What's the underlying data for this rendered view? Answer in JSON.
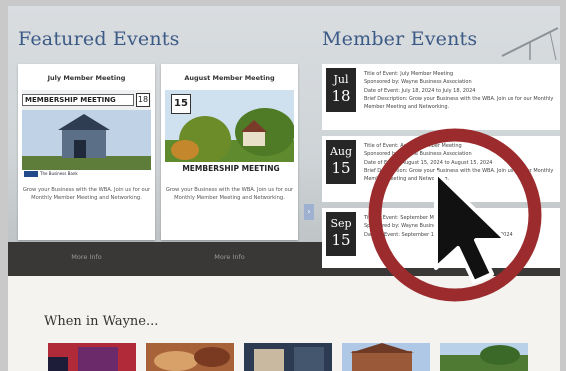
{
  "sections": {
    "featured_title": "Featured Events",
    "member_title": "Member Events",
    "wayne_title": "When in Wayne..."
  },
  "featured": [
    {
      "title": "July Member Meeting",
      "image_banner": "MEMBERSHIP MEETING",
      "image_corner": "18",
      "image_caption": "The Business Bank",
      "description": "Grow your Business with the WBA. Join us for our Monthly Member Meeting and Networking.",
      "more": "More Info"
    },
    {
      "title": "August Member Meeting",
      "image_banner": "MEMBERSHIP MEETING",
      "image_corner": "15",
      "description": "Grow your Business with the WBA. Join us for our Monthly Member Meeting and Networking.",
      "more": "More Info"
    }
  ],
  "member_events": [
    {
      "month": "Jul",
      "day": "18",
      "title": "Title of Event: July Member Meeting",
      "sponsor": "Sponsored by: Wayne Business Association",
      "dates": "Date of Event: July 18, 2024 to July 18, 2024",
      "desc": "Brief Description: Grow your Business with the WBA. Join us for our Monthly Member Meeting and Networking."
    },
    {
      "month": "Aug",
      "day": "15",
      "title": "Title of Event: August Member Meeting",
      "sponsor": "Sponsored by: Wayne Business Association",
      "dates": "Date of Event: August 15, 2024 to August 15, 2024",
      "desc": "Brief Description: Grow your Business with the WBA. Join us for our Monthly Member Meeting and Networking."
    },
    {
      "month": "Sep",
      "day": "15",
      "title": "Title of Event: September Member Meeting",
      "sponsor": "Sponsored by: Wayne Business Association",
      "dates": "Date of Event: September 15, 2024 to September 15, 2024",
      "desc": ""
    }
  ],
  "colors": {
    "accent_blue": "#3c5a86",
    "date_badge": "#262626",
    "highlight_ring": "#9b2b2c",
    "cursor": "#111111"
  },
  "icons": {
    "cursor": "arrow-pointer-icon",
    "carousel_next": "chevron-right-icon"
  },
  "arrow_glyph": "›"
}
